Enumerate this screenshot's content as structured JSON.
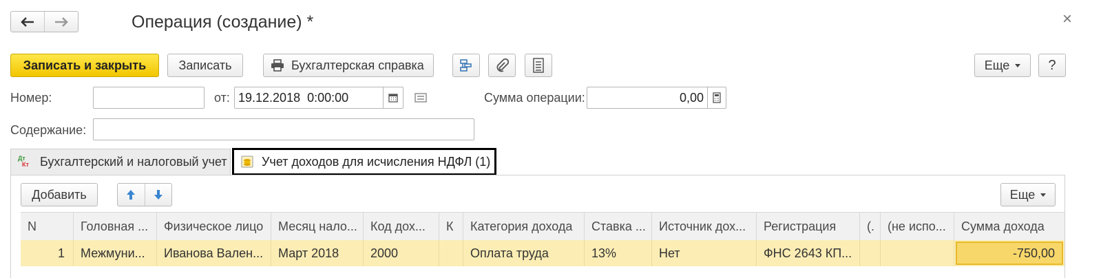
{
  "window": {
    "title": "Операция (создание) *",
    "close_glyph": "×",
    "back_glyph": "🡐",
    "forward_glyph": "🡒"
  },
  "toolbar": {
    "save_close_label": "Записать и закрыть",
    "save_label": "Записать",
    "report_label": "Бухгалтерская справка",
    "more_label": "Еще",
    "help_label": "?",
    "icons": [
      "structure-icon",
      "paperclip-icon",
      "list-icon"
    ]
  },
  "form": {
    "number_label": "Номер:",
    "number_value": "",
    "date_label": "от:",
    "date_value": "19.12.2018  0:00:00",
    "sum_label": "Сумма операции:",
    "sum_value": "0,00",
    "content_label": "Содержание:",
    "content_value": ""
  },
  "tabs": [
    {
      "label": "Бухгалтерский и налоговый учет",
      "icon": "dt-kt-icon",
      "active": false
    },
    {
      "label": "Учет доходов для исчисления НДФЛ (1)",
      "icon": "ndfl-icon",
      "active": true
    }
  ],
  "tab_icon_text": {
    "dt": "Дт",
    "kt": "Кт"
  },
  "table_toolbar": {
    "add_label": "Добавить",
    "more_label": "Еще",
    "up_icon": "arrow-up-icon",
    "down_icon": "arrow-down-icon"
  },
  "table": {
    "headers": [
      "N",
      "Головная ...",
      "Физическое лицо",
      "Месяц нало...",
      "Код дох...",
      "К",
      "Категория дохода",
      "Ставка ...",
      "Источник дох...",
      "Регистрация",
      "(.",
      "(не испо...",
      "Сумма дохода"
    ],
    "rows": [
      [
        "1",
        "Межмуни...",
        "Иванова Вален...",
        "Март 2018",
        "2000",
        "",
        "Оплата труда",
        "13%",
        "Нет",
        "ФНС 2643 КП...",
        "",
        "",
        "-750,00"
      ]
    ]
  },
  "colors": {
    "accent_yellow": "#f2c500",
    "row_highlight": "#fbedb4",
    "active_cell": "#f8d76a",
    "arrow_blue": "#3a86d1"
  }
}
